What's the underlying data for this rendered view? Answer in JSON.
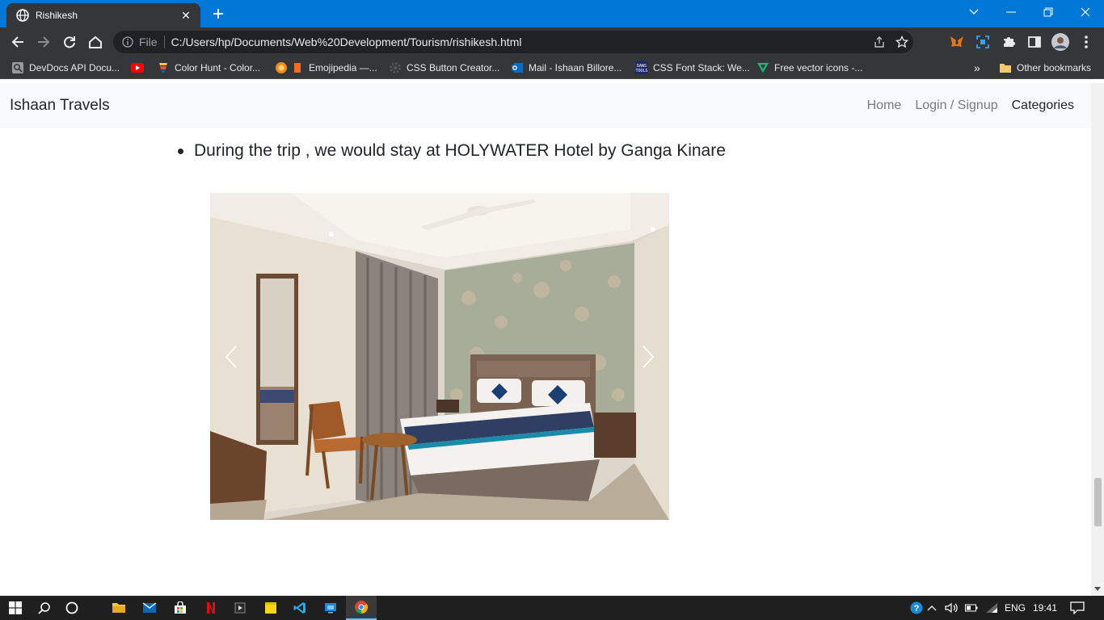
{
  "browser": {
    "tab_title": "Rishikesh",
    "scheme": "File",
    "url": "C:/Users/hp/Documents/Web%20Development/Tourism/rishikesh.html",
    "bookmarks": [
      {
        "label": "DevDocs API Docu...",
        "icon": "devdocs-icon"
      },
      {
        "label": "",
        "icon": "youtube-icon"
      },
      {
        "label": "Color Hunt - Color...",
        "icon": "color-hunt-icon"
      },
      {
        "label": "Emojipedia —...",
        "icon": "emojipedia-icon"
      },
      {
        "label": "CSS Button Creator...",
        "icon": "gear-icon"
      },
      {
        "label": "Mail - Ishaan Billore...",
        "icon": "outlook-icon"
      },
      {
        "label": "CSS Font Stack: We...",
        "icon": "font-stack-icon"
      },
      {
        "label": "Free vector icons -...",
        "icon": "vector-icon"
      }
    ],
    "more_bookmarks": "»",
    "other_bookmarks": "Other bookmarks"
  },
  "site": {
    "brand": "Ishaan Travels",
    "nav": {
      "home": "Home",
      "login": "Login / Signup",
      "categories": "Categories"
    },
    "bullet_text": "During the trip , we would stay at HOLYWATER Hotel by Ganga Kinare"
  },
  "taskbar": {
    "language": "ENG",
    "time": "19:41"
  },
  "colors": {
    "tabstrip": "#0078d7",
    "toolbar": "#35363a",
    "navbar": "#f8f9fa",
    "taskbar": "#1f1f1f"
  }
}
